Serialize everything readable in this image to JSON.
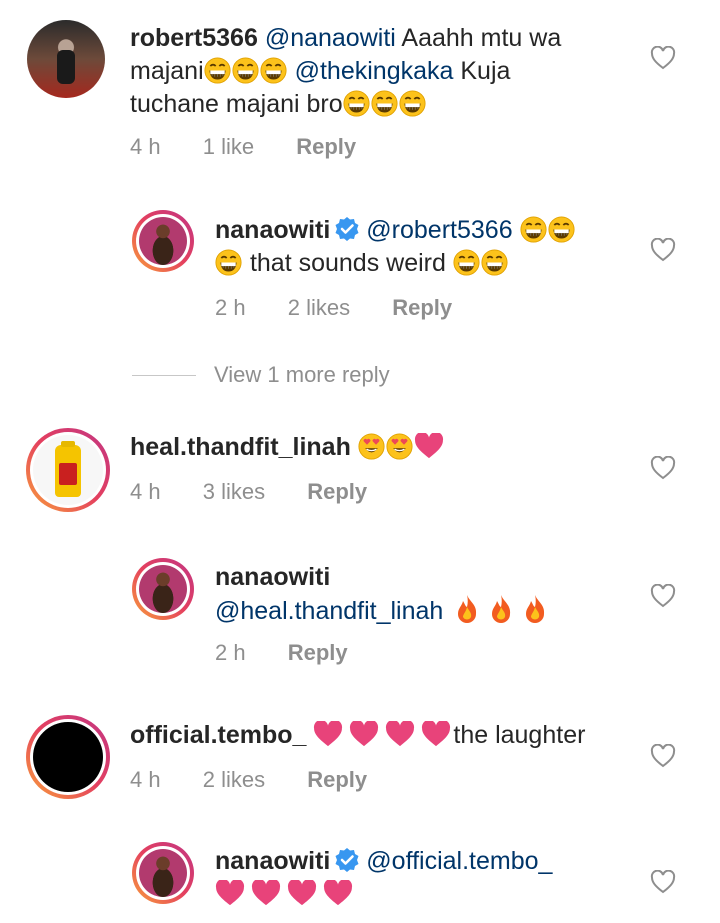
{
  "comments": [
    {
      "username": "robert5366",
      "mention1": "@nanaowiti",
      "text1": "Aaahh mtu wa",
      "text2": "majani",
      "mention2": "@thekingkaka",
      "text3": "Kuja",
      "text4": "tuchane majani bro",
      "time": "4 h",
      "likes": "1 like",
      "reply": "Reply"
    },
    {
      "username": "nanaowiti",
      "mention": "@robert5366",
      "text": "that sounds weird",
      "time": "2 h",
      "likes": "2 likes",
      "reply": "Reply"
    },
    {
      "username": "heal.thandfit_linah",
      "time": "4 h",
      "likes": "3 likes",
      "reply": "Reply"
    },
    {
      "username": "nanaowiti",
      "mention": "@heal.thandfit_linah",
      "time": "2 h",
      "reply": "Reply"
    },
    {
      "username": "official.tembo_",
      "text": "the laughter",
      "time": "4 h",
      "likes": "2 likes",
      "reply": "Reply"
    },
    {
      "username": "nanaowiti",
      "mention": "@official.tembo_"
    }
  ],
  "view_more": "View 1 more reply",
  "colors": {
    "mention": "#003569",
    "meta": "#8e8e8e",
    "verified": "#3897f0",
    "heart": "#ed4956"
  },
  "icons": [
    "laugh-emoji",
    "heart-eyes-emoji",
    "pink-heart",
    "fire-emoji",
    "verified-badge",
    "like-heart-outline"
  ]
}
